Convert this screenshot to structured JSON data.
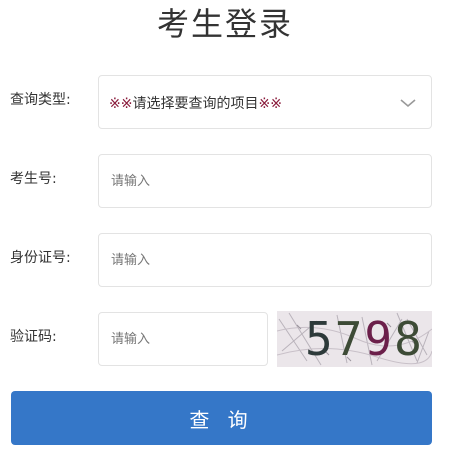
{
  "page": {
    "title": "考生登录"
  },
  "form": {
    "query_type": {
      "label": "查询类型:",
      "prefix": "※※",
      "selected": "请选择要查询的项目",
      "suffix": "※※",
      "icon": "chevron-down-icon"
    },
    "exam_number": {
      "label": "考生号:",
      "placeholder": "请输入",
      "value": ""
    },
    "id_number": {
      "label": "身份证号:",
      "placeholder": "请输入",
      "value": ""
    },
    "captcha": {
      "label": "验证码:",
      "placeholder": "请输入",
      "value": "",
      "image_text": "5798"
    },
    "submit_label": "查 询"
  },
  "colors": {
    "primary": "#3577c8",
    "border": "#e3e3e3",
    "text": "#333333",
    "placeholder": "#777777"
  }
}
